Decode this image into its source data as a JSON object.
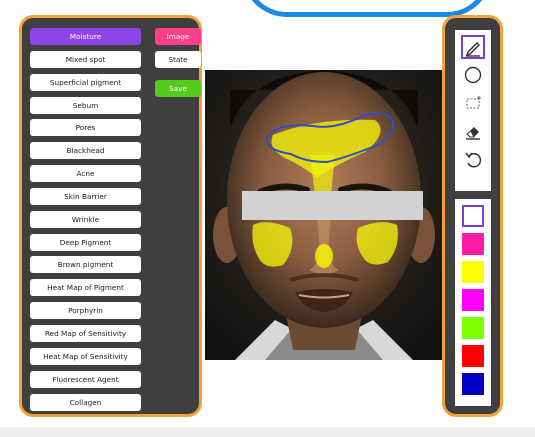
{
  "categories": [
    {
      "label": "Moisture",
      "active": true
    },
    {
      "label": "Mixed spot"
    },
    {
      "label": "Superficial pigment"
    },
    {
      "label": "Sebum"
    },
    {
      "label": "Pores"
    },
    {
      "label": "Blackhead"
    },
    {
      "label": "Acne"
    },
    {
      "label": "Skin Barrier"
    },
    {
      "label": "Wrinkle"
    },
    {
      "label": "Deep Pigment"
    },
    {
      "label": "Brown pigment"
    },
    {
      "label": "Heat Map of Pigment"
    },
    {
      "label": "Porphyrin"
    },
    {
      "label": "Red Map of Sensitivity"
    },
    {
      "label": "Heat Map of Sensitivity"
    },
    {
      "label": "Fluorescent Agent"
    },
    {
      "label": "Collagen"
    }
  ],
  "side_buttons": {
    "image_label": "Image",
    "state_label": "State",
    "save_label": "Save",
    "image_color": "#ff3d8b",
    "save_color": "#55cc1d"
  },
  "tools": [
    {
      "icon": "pencil-icon",
      "selected": true
    },
    {
      "icon": "circle-icon"
    },
    {
      "icon": "rectangle-icon"
    },
    {
      "icon": "eraser-icon"
    },
    {
      "icon": "undo-icon"
    }
  ],
  "colors": [
    {
      "name": "white",
      "hex": "#ffffff",
      "selected": true
    },
    {
      "name": "pink",
      "hex": "#ff1aa8"
    },
    {
      "name": "yellow",
      "hex": "#ffff00"
    },
    {
      "name": "magenta",
      "hex": "#ff00ff"
    },
    {
      "name": "green",
      "hex": "#7cff00"
    },
    {
      "name": "red",
      "hex": "#ff0000"
    },
    {
      "name": "blue",
      "hex": "#0000cc"
    }
  ],
  "theme": {
    "panel_bg": "#3f3f3f",
    "panel_border": "#f3a13b",
    "active_category": "#8d45ea",
    "overlay_yellow": "#f2f20a",
    "annotation_blue": "#2f4fc0"
  }
}
